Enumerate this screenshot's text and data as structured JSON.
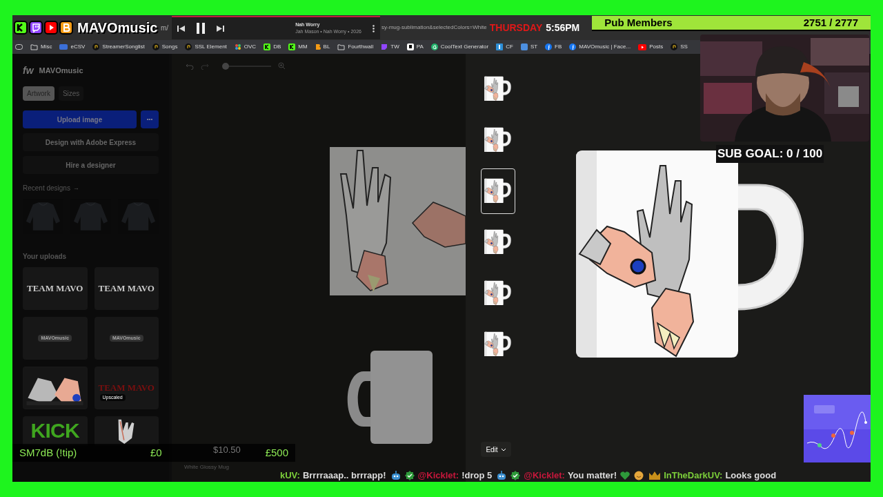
{
  "overlay": {
    "brand": "MAVOmusic",
    "day": "THURSDAY",
    "time": "5:56PM",
    "members": {
      "label": "Pub Members",
      "count": "2751 / 2777"
    },
    "sub_goal": "SUB GOAL: 0 / 100",
    "tip_goal": {
      "label": "SM7dB (!tip)",
      "current": "£0",
      "target": "£500"
    },
    "chat": [
      {
        "user": "kUV:",
        "text": "Brrrraaap.. brrrapp!",
        "color": "#7ccf3a",
        "kind": "plain"
      },
      {
        "user": "@Kicklet:",
        "text": "!drop 5",
        "color": "#c8173c",
        "kind": "bot"
      },
      {
        "user": "@Kicklet:",
        "text": "You matter!",
        "color": "#c8173c",
        "kind": "bot",
        "emotes": true
      },
      {
        "user": "InTheDarkUV:",
        "text": "Looks good",
        "color": "#7ccf3a",
        "kind": "vip"
      }
    ]
  },
  "player": {
    "title": "Nah Worry",
    "subtitle": "Jah Mason • Nah Worry • 2026",
    "playing": true
  },
  "browser": {
    "url_start": "m/",
    "url_end": "sy-mug-sublimation&selectedColors=White",
    "bookmarks": [
      {
        "label": "Misc",
        "kind": "folder"
      },
      {
        "label": "eCSV",
        "kind": "csv"
      },
      {
        "label": "StreamerSonglist",
        "kind": "music"
      },
      {
        "label": "Songs",
        "kind": "music"
      },
      {
        "label": "SSL Element",
        "kind": "music"
      },
      {
        "label": "OVC",
        "kind": "dots"
      },
      {
        "label": "DB",
        "kind": "kick"
      },
      {
        "label": "MM",
        "kind": "kick"
      },
      {
        "label": "BL",
        "kind": "b"
      },
      {
        "label": "Fourthwall",
        "kind": "folder"
      },
      {
        "label": "TW",
        "kind": "twitch"
      },
      {
        "label": "PA",
        "kind": "pa"
      },
      {
        "label": "CoolText Generator",
        "kind": "g"
      },
      {
        "label": "CF",
        "kind": "cf"
      },
      {
        "label": "ST",
        "kind": "st"
      },
      {
        "label": "FB",
        "kind": "facebook"
      },
      {
        "label": "MAVOmusic | Face...",
        "kind": "facebook"
      },
      {
        "label": "Posts",
        "kind": "youtube"
      },
      {
        "label": "SS",
        "kind": "music"
      }
    ]
  },
  "sidebar": {
    "logo": "fw",
    "account": "MAVOmusic",
    "tabs": [
      {
        "label": "Artwork",
        "selected": true
      },
      {
        "label": "Sizes",
        "selected": false
      }
    ],
    "upload": "Upload image",
    "more": "•••",
    "actions": [
      "Design with Adobe Express",
      "Hire a designer"
    ],
    "recent_title": "Recent designs",
    "recent_arrow": "→",
    "uploads_title": "Your uploads",
    "uploads": [
      {
        "kind": "wordmark",
        "text": "TEAM MAVO",
        "color": "#c9c9c9"
      },
      {
        "kind": "wordmark",
        "text": "TEAM MAVO",
        "color": "#c9c9c9"
      },
      {
        "kind": "logo",
        "text": "MAVOmusic"
      },
      {
        "kind": "logo",
        "text": "MAVOmusic"
      },
      {
        "kind": "hands"
      },
      {
        "kind": "wordmark",
        "text": "TEAM MAVO",
        "color": "#7a0f0f",
        "badge": "Upscaled"
      },
      {
        "kind": "kick",
        "text": "KICK",
        "color": "#3fa51f"
      },
      {
        "kind": "skeleton"
      }
    ]
  },
  "editor": {
    "zoom": {
      "level": 0.05
    },
    "price": "$10.50",
    "product": "White Glossy Mug"
  },
  "preview": {
    "thumbnails": [
      {
        "selected": false
      },
      {
        "selected": false
      },
      {
        "selected": true
      },
      {
        "selected": false
      },
      {
        "selected": false
      },
      {
        "selected": false
      }
    ],
    "edit": "Edit"
  }
}
